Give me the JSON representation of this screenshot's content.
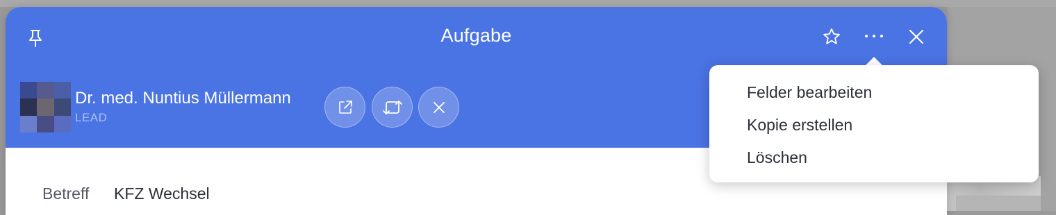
{
  "modal": {
    "title": "Aufgabe",
    "header_color": "#4a73e3"
  },
  "toolbar": {
    "pin_icon": "pin-icon",
    "star_icon": "star-icon",
    "more_icon": "more-horizontal-icon",
    "close_icon": "close-icon"
  },
  "contact": {
    "name": "Dr. med. Nuntius Müllermann",
    "role": "LEAD",
    "avatar_colors": [
      "#3a4a92",
      "#565a8e",
      "#4b5fa8",
      "#2b3152",
      "#6c6670",
      "#3d4a78",
      "#6a7fcc",
      "#4a4c85",
      "#5a6cc0"
    ],
    "actions": [
      {
        "name": "open-external",
        "icon": "external-link-icon"
      },
      {
        "name": "change",
        "icon": "swap-icon"
      },
      {
        "name": "remove",
        "icon": "close-icon"
      }
    ]
  },
  "details": {
    "subject_label": "Betreff",
    "subject_value": "KFZ Wechsel"
  },
  "menu": {
    "items": [
      {
        "label": "Felder bearbeiten"
      },
      {
        "label": "Kopie erstellen"
      },
      {
        "label": "Löschen"
      }
    ]
  }
}
